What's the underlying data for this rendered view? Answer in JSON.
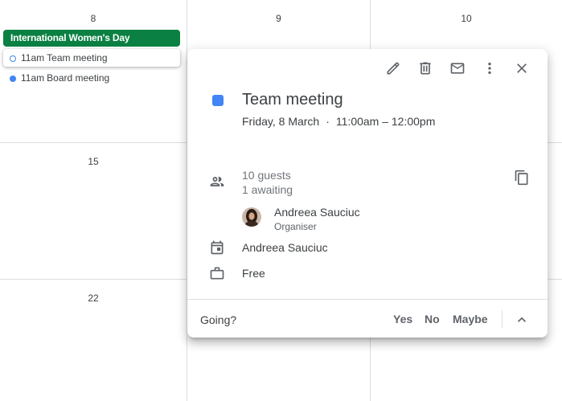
{
  "calendar": {
    "dates": {
      "d8": "8",
      "d9": "9",
      "d10": "10",
      "d15": "15",
      "d22": "22"
    },
    "events": {
      "allday_title": "International Women's Day",
      "allday_color": "#0b8043",
      "team_time": "11am",
      "team_title": "Team meeting",
      "board_time": "11am",
      "board_title": "Board meeting",
      "event_color": "#4285f4"
    }
  },
  "popup": {
    "toolbar": {
      "edit": "pencil-icon",
      "delete": "trash-icon",
      "email": "mail-icon",
      "more": "more-vert-icon",
      "close": "close-icon"
    },
    "title": "Team meeting",
    "date": "Friday, 8 March",
    "separator": "·",
    "time": "11:00am – 12:00pm",
    "guests": {
      "count": "10 guests",
      "status": "1 awaiting"
    },
    "organiser": {
      "name": "Andreea Sauciuc",
      "role": "Organiser"
    },
    "calendar_owner": "Andreea Sauciuc",
    "availability": "Free",
    "rsvp": {
      "label": "Going?",
      "yes": "Yes",
      "no": "No",
      "maybe": "Maybe"
    }
  }
}
